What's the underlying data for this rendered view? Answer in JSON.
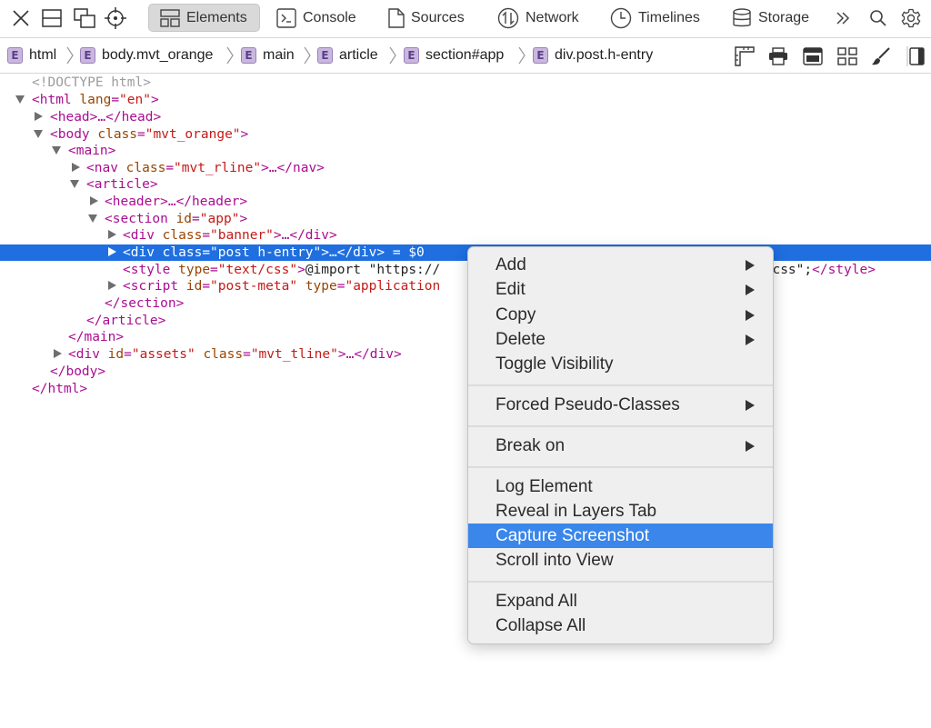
{
  "toolbar": {
    "icons": [
      "close-icon",
      "dock-icon",
      "undock-icon",
      "element-picker-icon"
    ],
    "tabs": [
      {
        "label": "Elements",
        "icon": "elements-icon",
        "active": true
      },
      {
        "label": "Console",
        "icon": "console-icon",
        "active": false
      },
      {
        "label": "Sources",
        "icon": "document-icon",
        "active": false
      },
      {
        "label": "Network",
        "icon": "network-icon",
        "active": false
      },
      {
        "label": "Timelines",
        "icon": "clock-icon",
        "active": false
      },
      {
        "label": "Storage",
        "icon": "database-icon",
        "active": false
      }
    ],
    "right_icons": [
      "overflow-icon",
      "search-icon",
      "gear-icon"
    ]
  },
  "breadcrumb": [
    "html",
    "body.mvt_orange",
    "main",
    "article",
    "section#app",
    "div.post.h-entry"
  ],
  "breadcrumb_badge": "E",
  "breadcrumb_tools": [
    "ruler-icon",
    "print-icon",
    "layout-icon",
    "grid-icon",
    "brush-icon",
    "sidebar-toggle-icon"
  ],
  "tree": {
    "doctype": "<!DOCTYPE html>",
    "html_open": {
      "tag": "<html",
      "attr": "lang",
      "value": "\"en\"",
      "close": ">"
    },
    "head": "<head>…</head>",
    "body_open": {
      "tag": "<body",
      "attr": "class",
      "value": "\"mvt_orange\"",
      "close": ">"
    },
    "main_open": "<main>",
    "nav": {
      "tag": "<nav",
      "attr": "class",
      "value": "\"mvt_rline\"",
      "close": ">…</nav>"
    },
    "article_open": "<article>",
    "header": "<header>…</header>",
    "section_open": {
      "tag": "<section",
      "attr": "id",
      "value": "\"app\"",
      "close": ">"
    },
    "banner": {
      "tag": "<div",
      "attr": "class",
      "value": "\"banner\"",
      "close": ">…</div>"
    },
    "post": {
      "tag": "<div",
      "attr": "class",
      "value": "\"post h-entry\"",
      "close": ">…</div>",
      "ref": " = $0"
    },
    "style": {
      "tag": "<style",
      "attr": "type",
      "value": "\"text/css\"",
      "gt": ">",
      "content": "@import \"https://",
      "tail": "6.css\";",
      "close": "</style>"
    },
    "script": {
      "tag": "<script",
      "attr1": "id",
      "value1": "\"post-meta\"",
      "attr2": "type",
      "value2": "\"application"
    },
    "section_close": "</section>",
    "article_close": "</article>",
    "main_close": "</main>",
    "assets": {
      "tag": "<div",
      "attr1": "id",
      "value1": "\"assets\"",
      "attr2": "class",
      "value2": "\"mvt_tline\"",
      "close": ">…</div>"
    },
    "body_close": "</body>",
    "html_close": "</html>"
  },
  "context_menu": {
    "items": [
      {
        "label": "Add",
        "submenu": true
      },
      {
        "label": "Edit",
        "submenu": true
      },
      {
        "label": "Copy",
        "submenu": true
      },
      {
        "label": "Delete",
        "submenu": true
      },
      {
        "label": "Toggle Visibility",
        "submenu": false
      },
      {
        "label": "Forced Pseudo-Classes",
        "submenu": true
      },
      {
        "label": "Break on",
        "submenu": true
      },
      {
        "label": "Log Element",
        "submenu": false
      },
      {
        "label": "Reveal in Layers Tab",
        "submenu": false
      },
      {
        "label": "Capture Screenshot",
        "submenu": false,
        "highlighted": true
      },
      {
        "label": "Scroll into View",
        "submenu": false
      },
      {
        "label": "Expand All",
        "submenu": false
      },
      {
        "label": "Collapse All",
        "submenu": false
      }
    ]
  },
  "colors": {
    "selection": "#1f6fe0",
    "menu_highlight": "#3a86ea",
    "tag": "#aa0d91",
    "attr_name": "#994500",
    "attr_value": "#c41a16"
  }
}
